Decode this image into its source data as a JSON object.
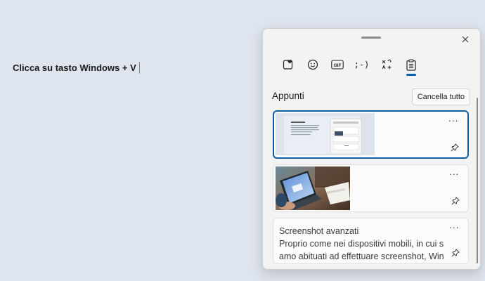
{
  "document": {
    "instruction": "Clicca su tasto Windows + V"
  },
  "clipboard_panel": {
    "close_icon": "close-icon",
    "tabs": [
      {
        "icon": "kaomoji-heart-icon",
        "active": false
      },
      {
        "icon": "emoji-smiley-icon",
        "active": false
      },
      {
        "icon": "gif-icon",
        "label": "GIF",
        "active": false
      },
      {
        "icon": "kaomoji-icon",
        "label": ";-)",
        "active": false
      },
      {
        "icon": "symbols-icon",
        "active": false
      },
      {
        "icon": "clipboard-icon",
        "active": true
      }
    ],
    "section_title": "Appunti",
    "clear_all_label": "Cancella tutto",
    "items": [
      {
        "type": "image",
        "description": "screenshot-thumbnail",
        "menu_label": "···",
        "pin_icon": "pin-icon",
        "selected": true
      },
      {
        "type": "image",
        "description": "laptop-photo-thumbnail",
        "menu_label": "···",
        "pin_icon": "pin-icon",
        "selected": false
      },
      {
        "type": "text",
        "menu_label": "···",
        "pin_icon": "pin-icon",
        "selected": false,
        "lines": [
          "Screenshot avanzati",
          "Proprio come nei dispositivi mobili, in cui si",
          "amo abituati ad effettuare screenshot, Win"
        ]
      }
    ],
    "colors": {
      "accent": "#005fb8",
      "selected_border": "#0a5ea8",
      "panel_bg": "#f3f3f3"
    }
  }
}
